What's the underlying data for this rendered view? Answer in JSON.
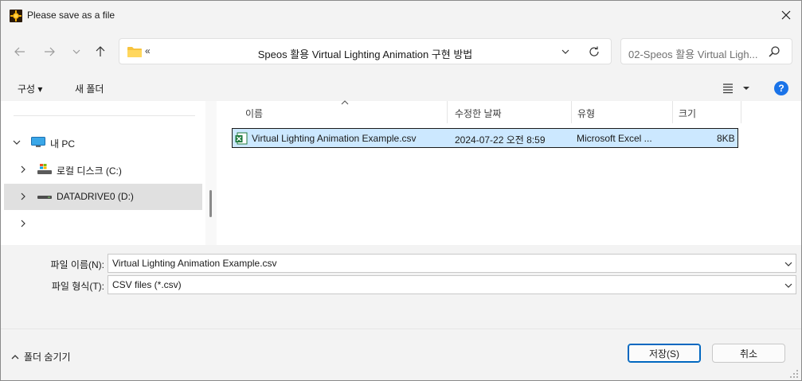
{
  "window": {
    "title": "Please save as a file"
  },
  "navbar": {
    "address_prefix": "«",
    "address_path": "Speos 활용 Virtual Lighting Animation 구현 방법",
    "search_placeholder": "02-Speos 활용 Virtual Ligh..."
  },
  "toolbar": {
    "organize_label": "구성 ▾",
    "new_folder_label": "새 폴더",
    "help_label": "?"
  },
  "nav_tree": {
    "items": [
      {
        "label": "내 PC",
        "icon": "computer-icon",
        "expanded": true
      },
      {
        "label": "로컬 디스크 (C:)",
        "icon": "local-disk-icon",
        "expanded": false
      },
      {
        "label": "DATADRIVE0 (D:)",
        "icon": "drive-icon",
        "expanded": false,
        "selected": true
      },
      {
        "label": "",
        "icon": "",
        "expanded": false
      }
    ]
  },
  "file_list": {
    "columns": [
      "이름",
      "수정한 날짜",
      "유형",
      "크기"
    ],
    "rows": [
      {
        "name": "Virtual Lighting Animation Example.csv",
        "modified": "2024-07-22 오전 8:59",
        "type": "Microsoft Excel ...",
        "size": "8KB",
        "icon": "excel-csv-icon",
        "selected": true
      }
    ]
  },
  "fields": {
    "filename_label": "파일 이름(N):",
    "filename_value": "Virtual Lighting Animation Example.csv",
    "filetype_label": "파일 형식(T):",
    "filetype_value": "CSV files (*.csv)"
  },
  "footer": {
    "hide_folders_label": "폴더 숨기기",
    "save_label": "저장(S)",
    "cancel_label": "취소"
  },
  "colors": {
    "accent": "#0067c0",
    "selection": "#cce8ff",
    "help": "#1a73e8",
    "excel": "#1f7a3e"
  }
}
